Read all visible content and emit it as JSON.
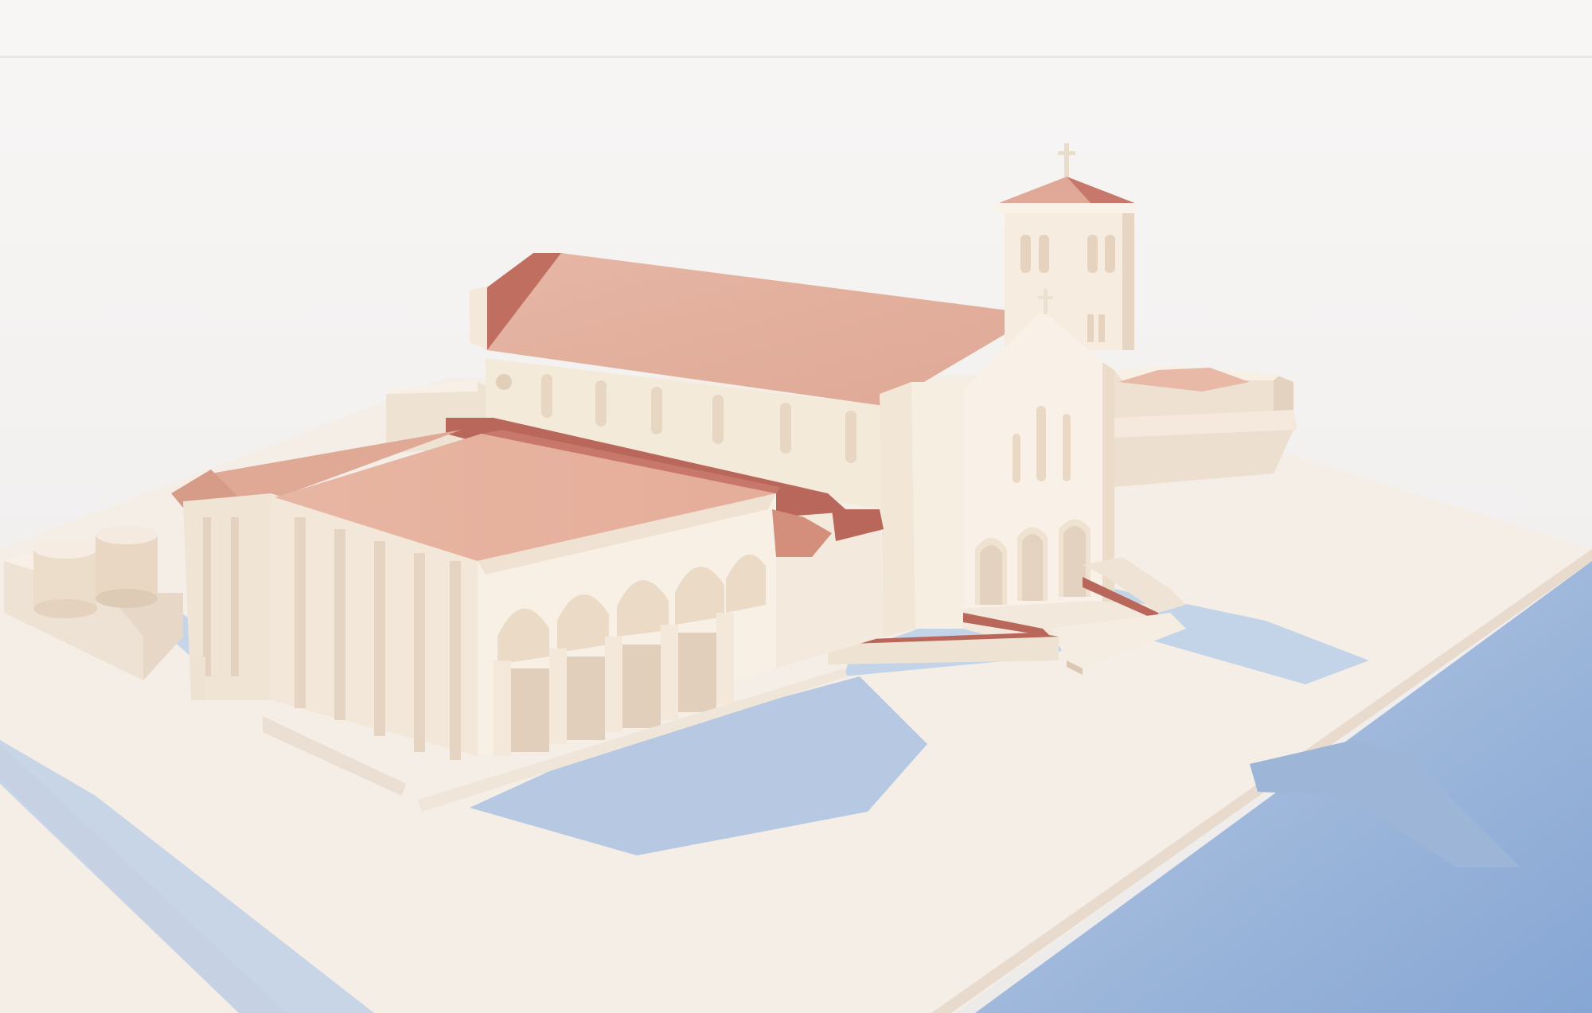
{
  "scene": {
    "description_visible_text": "",
    "palette": {
      "sky_top": "#f7f5f4",
      "sky_bottom": "#ecebea",
      "ground": "#f6efe8",
      "ground_edge": "#efe6dc",
      "wall_light": "#f8f0e6",
      "wall_mid": "#efe3d4",
      "wall_shade": "#e2d2c1",
      "roof_light": "#e9b9a5",
      "roof_mid": "#d99a86",
      "roof_dark": "#b9675b",
      "shadow": "#9db6d8",
      "shadow_deep": "#87a6d2"
    }
  }
}
